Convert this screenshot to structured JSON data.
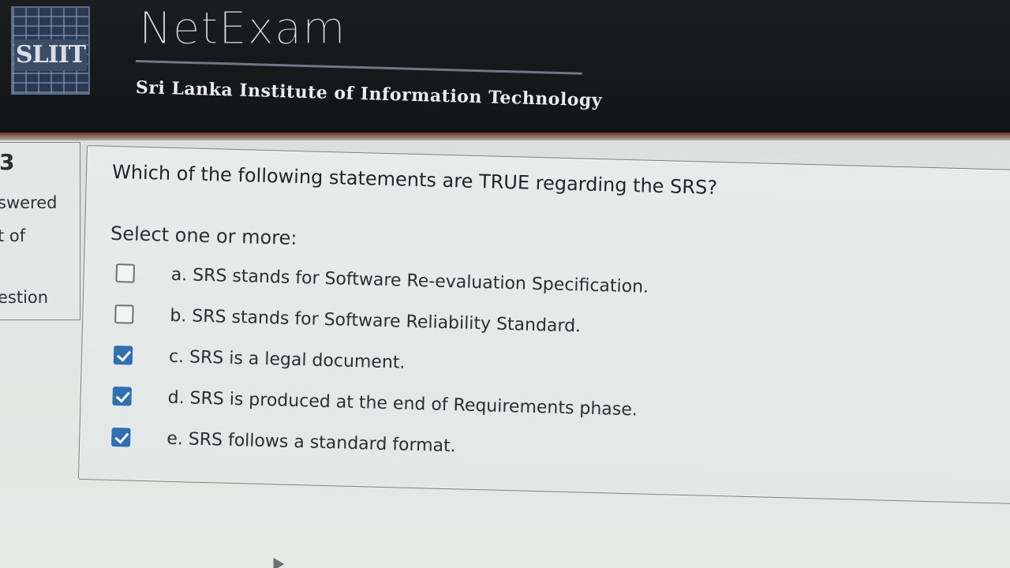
{
  "header": {
    "logo_text": "SLIIT",
    "title": "NetExam",
    "subtitle": "Sri Lanka Institute of Information Technology"
  },
  "info": {
    "number": "3",
    "lines": [
      "swered",
      "t of",
      "estion"
    ]
  },
  "question": {
    "text": "Which of the following statements are TRUE regarding the SRS?",
    "prompt": "Select one or more:",
    "options": [
      {
        "label": "a. SRS stands for Software Re-evaluation Specification.",
        "checked": false
      },
      {
        "label": "b. SRS stands for Software Reliability Standard.",
        "checked": false
      },
      {
        "label": "c. SRS is a legal document.",
        "checked": true
      },
      {
        "label": "d. SRS is produced at the end of Requirements phase.",
        "checked": true
      },
      {
        "label": "e. SRS follows a standard format.",
        "checked": true
      }
    ]
  },
  "colors": {
    "header_bg": "#121416",
    "checkbox_checked": "#2f6fb4",
    "page_bg": "#e2e6e4"
  }
}
